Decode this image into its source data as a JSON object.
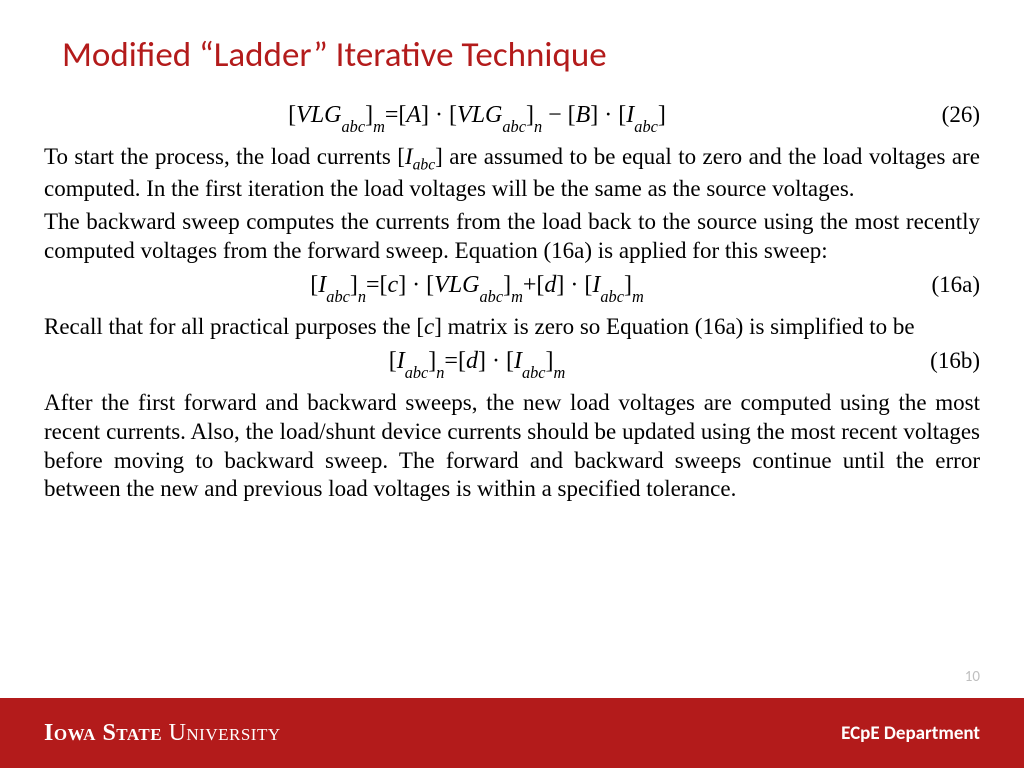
{
  "title": "Modified “Ladder” Iterative Technique",
  "eq26": {
    "text": "[VLG_{abc}]_m = [A] · [VLG_{abc}]_n − [B] · [I_{abc}]",
    "num": "(26)"
  },
  "para1_a": "To start the process, the load currents [",
  "para1_sym": "I",
  "para1_sub": "abc",
  "para1_b": "] are assumed to be equal to zero and the load voltages are computed. In the first iteration the load voltages will be the same as the source voltages.",
  "para2": "The backward sweep computes the currents from the load back to the source using the most recently computed voltages from the forward sweep. Equation (16a) is applied for this sweep:",
  "eq16a": {
    "text": "[I_{abc}]_n = [c] · [VLG_{abc}]_m + [d] · [I_{abc}]_m",
    "num": "(16a)"
  },
  "para3_a": "Recall that for all practical purposes the [",
  "para3_sym": "c",
  "para3_b": "] matrix is zero so Equation (16a) is simplified to be",
  "eq16b": {
    "text": "[I_{abc}]_n = [d] · [I_{abc}]_m",
    "num": "(16b)"
  },
  "para4": "After the first forward and backward sweeps, the new load voltages are computed using the most recent currents. Also, the load/shunt device currents should be updated using the most recent voltages before moving to backward sweep. The forward and backward sweeps continue until the error between the new and previous load voltages is within a specified tolerance.",
  "slidenum": "10",
  "footer": {
    "university_iowa": "Iowa State",
    "university_rest": " University",
    "department": "ECpE Department"
  }
}
